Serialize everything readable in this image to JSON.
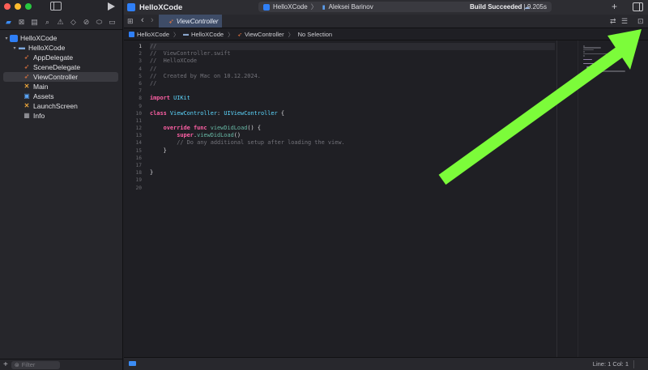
{
  "sidebar": {
    "tree": [
      {
        "label": "HelloXCode",
        "icon": "project-icon",
        "level": 0,
        "disclosure": "▾"
      },
      {
        "label": "HelloXCode",
        "icon": "folder-icon",
        "level": 1,
        "disclosure": "▾"
      },
      {
        "label": "AppDelegate",
        "icon": "swift-file-icon",
        "level": 2
      },
      {
        "label": "SceneDelegate",
        "icon": "swift-file-icon",
        "level": 2
      },
      {
        "label": "ViewController",
        "icon": "swift-file-icon",
        "level": 2,
        "selected": true
      },
      {
        "label": "Main",
        "icon": "storyboard-icon",
        "level": 2
      },
      {
        "label": "Assets",
        "icon": "asset-catalog-icon",
        "level": 2
      },
      {
        "label": "LaunchScreen",
        "icon": "storyboard-icon",
        "level": 2
      },
      {
        "label": "Info",
        "icon": "plist-icon",
        "level": 2
      }
    ],
    "filter_placeholder": "Filter"
  },
  "titlebar": {
    "project_title": "HelloXCode",
    "scheme_name": "HelloXCode",
    "run_destination": "Aleksei Barinov",
    "build_status_bold": "Build Succeeded",
    "build_time": " | 9.205s"
  },
  "tabbar": {
    "active_tab": "ViewController"
  },
  "jumpbar": {
    "crumbs": [
      "HelloXCode",
      "HelloXCode",
      "ViewController",
      "No Selection"
    ]
  },
  "editor": {
    "line_numbers": [
      "1",
      "2",
      "3",
      "4",
      "5",
      "6",
      "7",
      "8",
      "9",
      "10",
      "11",
      "12",
      "13",
      "14",
      "15",
      "16",
      "17",
      "18",
      "19",
      "20"
    ],
    "current_line": 1,
    "lines": [
      "//",
      "//  ViewController.swift",
      "//  HelloXCode",
      "//",
      "//  Created by Mac on 10.12.2024.",
      "//",
      "",
      "import UIKit",
      "",
      "class ViewController: UIViewController {",
      "",
      "    override func viewDidLoad() {",
      "        super.viewDidLoad()",
      "        // Do any additional setup after loading the view.",
      "    }",
      "",
      "",
      "}",
      "",
      ""
    ]
  },
  "statusbar": {
    "cursor_position": "Line: 1  Col: 1"
  },
  "colors": {
    "keyword": "#fc5fa3",
    "type": "#5dd8ff",
    "function": "#67b7a4",
    "comment": "#73737a",
    "accent": "#3b8cf5",
    "annotation_arrow": "#7cfc3a"
  }
}
